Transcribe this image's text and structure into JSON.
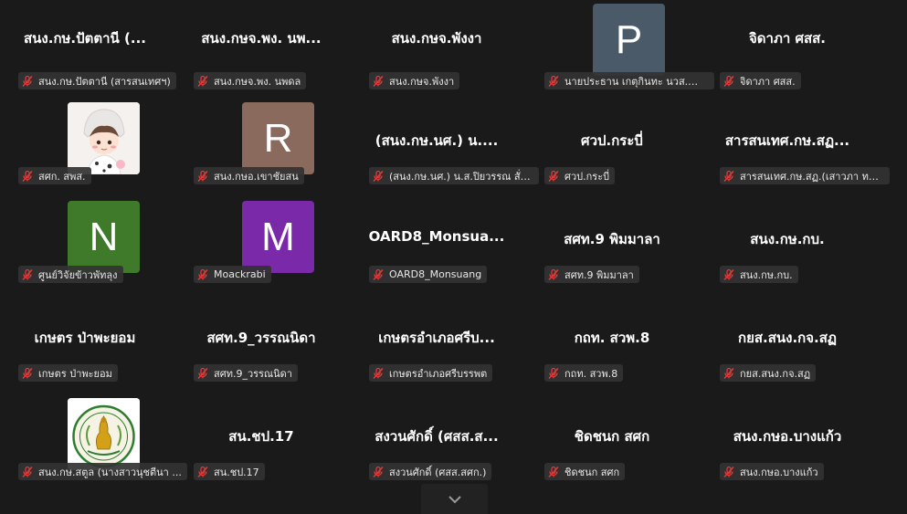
{
  "colors": {
    "background": "#1a1a1a",
    "mute_icon": "#e03a3a",
    "avatar_p": "#4a5a68",
    "avatar_r": "#8b6a5e",
    "avatar_n": "#3f7a2a",
    "avatar_m": "#7a2aa8"
  },
  "participants": [
    {
      "title": "สนง.กษ.ปัตตานี (...",
      "name": "สนง.กษ.ปัตตานี (สารสนเทศฯ)"
    },
    {
      "title": "สนง.กษจ.พง. นพ...",
      "name": "สนง.กษจ.พง. นพดล"
    },
    {
      "title": "สนง.กษจ.พังงา",
      "name": "สนง.กษจ.พังงา"
    },
    {
      "avatar_letter": "P",
      "name": "นายประธาน  เกตุกินทะ นวส.ชำ..."
    },
    {
      "title": "จิดาภา ศสส.",
      "name": "จิดาภา ศสส."
    },
    {
      "avatar_image": "cartoon-avatar",
      "name": "สศก. สพส."
    },
    {
      "avatar_letter": "R",
      "name": "สนง.กษอ.เขาชัยสน"
    },
    {
      "title": "(สนง.กษ.นศ.) น....",
      "name": "(สนง.กษ.นศ.) น.ส.ปิยวรรณ สั่ง..."
    },
    {
      "title": "ศวป.กระบี่",
      "name": "ศวป.กระบี่"
    },
    {
      "title": "สารสนเทศ.กษ.สฏ...",
      "name": "สารสนเทศ.กษ.สฏ.(เสาวภา ทอง..."
    },
    {
      "avatar_letter": "N",
      "name": "ศูนย์วิจัยข้าวพัทลุง"
    },
    {
      "avatar_letter": "M",
      "name": "Moackrabi"
    },
    {
      "title": "OARD8_Monsua...",
      "name": "OARD8_Monsuang"
    },
    {
      "title": "สศท.9 พิมมาลา",
      "name": "สศท.9 พิมมาลา"
    },
    {
      "title": "สนง.กษ.กบ.",
      "name": "สนง.กษ.กบ."
    },
    {
      "title": "เกษตร ป่าพะยอม",
      "name": "เกษตร ป่าพะยอม"
    },
    {
      "title": "สศท.9_วรรณนิดา",
      "name": "สศท.9_วรรณนิดา"
    },
    {
      "title": "เกษตรอำเภอศรีบ...",
      "name": "เกษตรอำเภอศรีบรรพต"
    },
    {
      "title": "กถท. สวพ.8",
      "name": "กถท. สวพ.8"
    },
    {
      "title": "กยส.สนง.กจ.สฏ",
      "name": "กยส.สนง.กจ.สฏ"
    },
    {
      "avatar_image": "seal-avatar",
      "name": "สนง.กษ.สตูล (นางสาวนุชตีนา ..."
    },
    {
      "title": "สน.ชป.17",
      "name": "สน.ชป.17"
    },
    {
      "title": "สงวนศักดิ์ (ศสส.ส...",
      "name": "สงวนศักดิ์ (ศสส.สศก.)"
    },
    {
      "title": "ชิดชนก สศก",
      "name": "ชิดชนก สศก"
    },
    {
      "title": "สนง.กษอ.บางแก้ว",
      "name": "สนง.กษอ.บางแก้ว"
    }
  ],
  "scroll_icon": "chevron-down-icon"
}
